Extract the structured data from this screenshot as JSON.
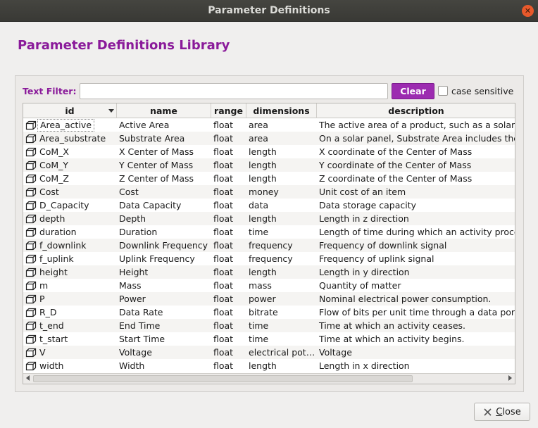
{
  "window": {
    "title": "Parameter Definitions"
  },
  "heading": "Parameter Definitions Library",
  "filter": {
    "label": "Text Filter:",
    "value": "",
    "clear_label": "Clear",
    "case_sensitive_label": "case sensitive",
    "case_sensitive_checked": false
  },
  "table": {
    "columns": [
      "id",
      "name",
      "range",
      "dimensions",
      "description"
    ],
    "sorted_column": "id",
    "selected_row": 0,
    "rows": [
      {
        "id": "Area_active",
        "name": "Active Area",
        "range": "float",
        "dimensions": "area",
        "description": "The active area of a product, such as a solar p"
      },
      {
        "id": "Area_substrate",
        "name": "Substrate Area",
        "range": "float",
        "dimensions": "area",
        "description": "On a solar panel, Substrate Area includes the A"
      },
      {
        "id": "CoM_X",
        "name": "X Center of Mass",
        "range": "float",
        "dimensions": "length",
        "description": "X coordinate of the Center of Mass"
      },
      {
        "id": "CoM_Y",
        "name": "Y Center of Mass",
        "range": "float",
        "dimensions": "length",
        "description": "Y coordinate of the Center of Mass"
      },
      {
        "id": "CoM_Z",
        "name": "Z Center of Mass",
        "range": "float",
        "dimensions": "length",
        "description": "Z coordinate of the Center of Mass"
      },
      {
        "id": "Cost",
        "name": "Cost",
        "range": "float",
        "dimensions": "money",
        "description": "Unit cost of an item"
      },
      {
        "id": "D_Capacity",
        "name": "Data Capacity",
        "range": "float",
        "dimensions": "data",
        "description": "Data storage capacity"
      },
      {
        "id": "depth",
        "name": "Depth",
        "range": "float",
        "dimensions": "length",
        "description": "Length in z direction"
      },
      {
        "id": "duration",
        "name": "Duration",
        "range": "float",
        "dimensions": "time",
        "description": "Length of time during which an activity procee"
      },
      {
        "id": "f_downlink",
        "name": "Downlink Frequency",
        "range": "float",
        "dimensions": "frequency",
        "description": "Frequency of downlink signal"
      },
      {
        "id": "f_uplink",
        "name": "Uplink Frequency",
        "range": "float",
        "dimensions": "frequency",
        "description": "Frequency of uplink signal"
      },
      {
        "id": "height",
        "name": "Height",
        "range": "float",
        "dimensions": "length",
        "description": "Length in y direction"
      },
      {
        "id": "m",
        "name": "Mass",
        "range": "float",
        "dimensions": "mass",
        "description": "Quantity of matter"
      },
      {
        "id": "P",
        "name": "Power",
        "range": "float",
        "dimensions": "power",
        "description": "Nominal electrical power consumption."
      },
      {
        "id": "R_D",
        "name": "Data Rate",
        "range": "float",
        "dimensions": "bitrate",
        "description": "Flow of bits per unit time through a data port."
      },
      {
        "id": "t_end",
        "name": "End Time",
        "range": "float",
        "dimensions": "time",
        "description": "Time at which an activity ceases."
      },
      {
        "id": "t_start",
        "name": "Start Time",
        "range": "float",
        "dimensions": "time",
        "description": "Time at which an activity begins."
      },
      {
        "id": "V",
        "name": "Voltage",
        "range": "float",
        "dimensions": "electrical pot…",
        "description": "Voltage"
      },
      {
        "id": "width",
        "name": "Width",
        "range": "float",
        "dimensions": "length",
        "description": "Length in x direction"
      }
    ]
  },
  "footer": {
    "close_label": "Close",
    "close_mnemonic": "C",
    "close_rest": "lose"
  },
  "colors": {
    "accent": "#8a1a9a",
    "button": "#9c2bb0"
  },
  "icons": {
    "row_icon": "cube-icon",
    "window_close": "close-icon"
  }
}
